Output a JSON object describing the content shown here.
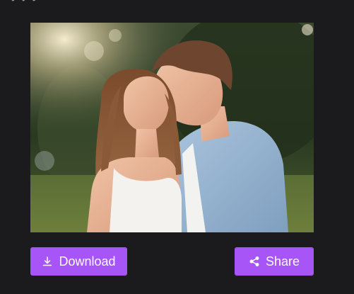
{
  "top_fragment": "• • •",
  "image": {
    "alt": "photo"
  },
  "actions": {
    "download_label": "Download",
    "share_label": "Share",
    "download_icon": "download-icon",
    "share_icon": "share-icon"
  },
  "colors": {
    "background": "#1b1b1d",
    "button": "#a855f7",
    "button_text": "#ffffff"
  }
}
